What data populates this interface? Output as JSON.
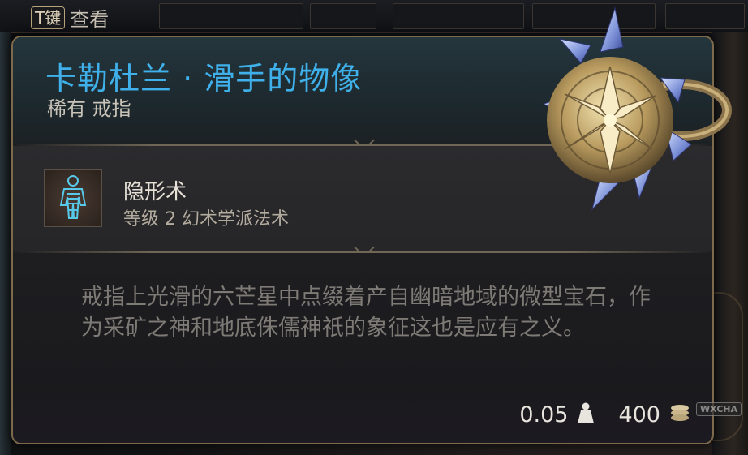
{
  "hotkey": {
    "key": "T键",
    "label": "查看"
  },
  "item": {
    "name": "卡勒杜兰 · 滑手的物像",
    "rarity_type": "稀有 戒指",
    "spell": {
      "name": "隐形术",
      "detail": "等级 2 幻术学派法术"
    },
    "flavor_text": "戒指上光滑的六芒星中点缀着产自幽暗地域的微型宝石，作为采矿之神和地底侏儒神祇的象征这也是应有之义。",
    "weight": "0.05",
    "value": "400",
    "weight_icon": "weight-icon",
    "value_icon": "gold-coin-icon"
  },
  "watermark": "WXCHA",
  "colors": {
    "title": "#3fb0ea",
    "border": "#7d6a4c"
  }
}
